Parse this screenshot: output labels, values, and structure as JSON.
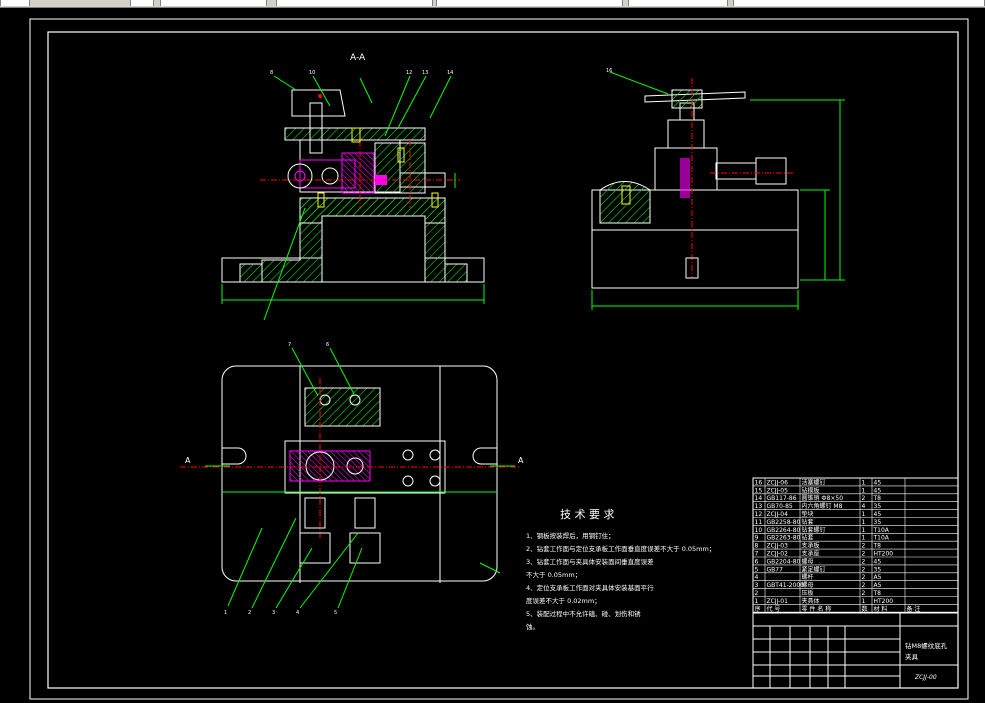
{
  "drawing": {
    "section_label": "A-A",
    "cut_label_left": "A",
    "cut_label_right": "A",
    "tech_title": "技 术 要 求",
    "tech_notes": [
      "1、钢板按装焊后，用钢钉住；",
      "2、钻套工作面与定位支承板工作面垂直度误差不大于 0.05mm；",
      "3、钻套工作面与夹具体安装面间垂直度误差",
      "不大于 0.05mm；",
      "4、定位支承板工作面对夹具体安装基面平行",
      "度误差不大于 0.02mm；",
      "5、装配过程中不允许磕、碰、划伤和锈",
      "蚀。"
    ],
    "callouts_top": [
      "8",
      "10",
      "12",
      "13",
      "14"
    ],
    "callouts_bottom": [
      "1",
      "2",
      "3",
      "4",
      "5",
      "6",
      "7"
    ],
    "callout_right": "16"
  },
  "title_block": {
    "title_line1": "钻M8螺纹底孔",
    "title_line2": "夹具",
    "drawing_no": "ZCJJ-00",
    "material_header": [
      "序",
      "代 号",
      "零 件 名 称",
      "数",
      "材 料",
      "备 注"
    ],
    "bom": [
      {
        "no": "16",
        "code": "ZCJJ-06",
        "name": "活塞螺钉",
        "qty": "1",
        "mat": "45"
      },
      {
        "no": "15",
        "code": "ZCJJ-05",
        "name": "钻模板",
        "qty": "1",
        "mat": "45"
      },
      {
        "no": "14",
        "code": "GB117-86",
        "name": "圆锥销 Ф8×50",
        "qty": "2",
        "mat": "T8"
      },
      {
        "no": "13",
        "code": "GB70-85",
        "name": "内六角螺钉 M8",
        "qty": "4",
        "mat": "35"
      },
      {
        "no": "12",
        "code": "ZCJJ-04",
        "name": "垫块",
        "qty": "1",
        "mat": "45"
      },
      {
        "no": "11",
        "code": "GB2258-80",
        "name": "钻套",
        "qty": "1",
        "mat": "35"
      },
      {
        "no": "10",
        "code": "GB2264-80",
        "name": "钻套螺钉",
        "qty": "1",
        "mat": "T10A"
      },
      {
        "no": "9",
        "code": "GB2263-80",
        "name": "钻套",
        "qty": "1",
        "mat": "T10A"
      },
      {
        "no": "8",
        "code": "ZCJJ-03",
        "name": "支承板",
        "qty": "2",
        "mat": "T8"
      },
      {
        "no": "7",
        "code": "ZCJJ-02",
        "name": "支承座",
        "qty": "2",
        "mat": "HT200"
      },
      {
        "no": "6",
        "code": "GB2204-80",
        "name": "螺母",
        "qty": "2",
        "mat": "45"
      },
      {
        "no": "5",
        "code": "GB77",
        "name": "紧定螺钉",
        "qty": "2",
        "mat": "35"
      },
      {
        "no": "4",
        "code": "",
        "name": "螺杆",
        "qty": "2",
        "mat": "A5"
      },
      {
        "no": "3",
        "code": "GBT41-2000",
        "name": "螺母",
        "qty": "2",
        "mat": "A5"
      },
      {
        "no": "2",
        "code": "",
        "name": "压板",
        "qty": "2",
        "mat": "T8"
      },
      {
        "no": "1",
        "code": "ZCJJ-01",
        "name": "夹具体",
        "qty": "1",
        "mat": "HT200"
      }
    ]
  }
}
